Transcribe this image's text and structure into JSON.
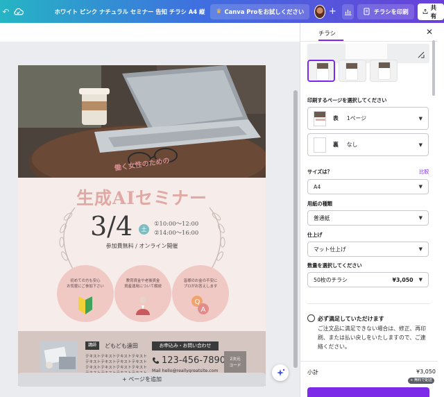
{
  "topbar": {
    "title": "ホワイト ピンク ナチュラル セミナー 告知 チラシ A4 縦",
    "pro_label": "Canva Proをお試しください",
    "plus_label": "+",
    "print_label": "チラシを印刷",
    "share_label": "共有"
  },
  "canvas": {
    "add_page_label": "+ ページを追加"
  },
  "flyer": {
    "tagline": "働く女性のための",
    "title": "生成AIセミナー",
    "date": "3/4",
    "weekday": "土",
    "times": [
      "①10:00～12:00",
      "②14:00～16:00"
    ],
    "attendance": "参加費無料 / オンライン開催",
    "circles": [
      {
        "text": "初めての方も安心\nお気軽にご参加下さい",
        "icon": "beginner-mark-icon"
      },
      {
        "text": "教育資金や老後資金\n資産運用について解説",
        "icon": "businesswoman-icon"
      },
      {
        "text": "皆様のお金の不安に\nプロがお答えします",
        "icon": "qa-bubble-icon"
      }
    ],
    "lecturer_badge": "講師",
    "lecturer_name": "どもども遠田",
    "dummy_lines": [
      "テキストテキストテキストテキスト",
      "テキストテキストテキストテキスト",
      "テキストテキストテキストテキスト",
      "テキストテキストテキストテキスト"
    ],
    "contact_heading": "お申込み・お問い合わせ",
    "phone": "123-456-7890",
    "mail": "Mail  hello@reallygreatsite.com",
    "qr_label_1": "2次元",
    "qr_label_2": "コード"
  },
  "panel": {
    "tab_label": "チラシ",
    "close_label": "✕",
    "pages_label": "印刷するページを選択してください",
    "front": {
      "label": "表",
      "value": "1ページ"
    },
    "back": {
      "label": "裏",
      "value": "なし"
    },
    "size_label": "サイズは？",
    "compare_label": "比較",
    "size_value": "A4",
    "paper_label": "用紙の種類",
    "paper_value": "普通紙",
    "finish_label": "仕上げ",
    "finish_value": "マット仕上げ",
    "quantity_label": "数量を選択してください",
    "quantity_value": "50枚のチラシ",
    "quantity_price": "¥3,050",
    "satisfy_title": "必ず満足していただけます",
    "satisfy_text": "ご注文品に満足できない場合は、修正、再印刷、または払い戻しをいたしますので、ご連絡ください。",
    "subtotal_label": "小計",
    "subtotal_value": "¥3,050",
    "free_shipping": "+ 無料で配送"
  },
  "colors": {
    "accent": "#7d2ae8",
    "title_pink": "#e0a9a3",
    "circle_pink": "#f0c9c5",
    "footer_band": "#d5c6c2"
  }
}
